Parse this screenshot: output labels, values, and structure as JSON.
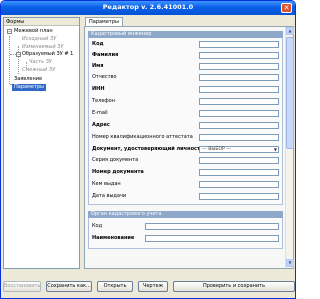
{
  "window": {
    "title": "Редактор v. 2.6.41001.0",
    "close_glyph": "✕"
  },
  "left": {
    "header": "Формы",
    "tree": [
      {
        "label": "Межевой план",
        "expander": "−"
      },
      {
        "label": "Исходный ЗУ"
      },
      {
        "label": "Изменяемый ЗУ"
      },
      {
        "label": "Образуемый ЗУ # 1",
        "expander": "−"
      },
      {
        "label": "Часть ЗУ"
      },
      {
        "label": "Смежный ЗУ"
      },
      {
        "label": "Заявление"
      },
      {
        "label": "Параметры"
      }
    ]
  },
  "right": {
    "tab": "Параметры",
    "engineer": {
      "section": "Кадастровый инженер",
      "fields": [
        {
          "label": "Код"
        },
        {
          "label": "Фамилия"
        },
        {
          "label": "Имя"
        },
        {
          "label": "Отчество"
        },
        {
          "label": "ИНН"
        },
        {
          "label": "Телефон"
        },
        {
          "label": "E-mail"
        },
        {
          "label": "Адрес"
        },
        {
          "label": "Номер квалификационного аттестата"
        },
        {
          "label": "Документ, удостоверяющий личность",
          "value": "--- ВЫБОР ---"
        },
        {
          "label": "Серия документа"
        },
        {
          "label": "Номер документа"
        },
        {
          "label": "Кем выдан"
        },
        {
          "label": "Дата выдачи"
        }
      ]
    },
    "organ": {
      "section": "Орган кадастрового учета",
      "fields": [
        {
          "label": "Код"
        },
        {
          "label": "Наименование"
        }
      ]
    }
  },
  "buttons": {
    "restore": "Восстановить",
    "save_as": "Сохранить как...",
    "open": "Открыть",
    "drawing": "Чертеж",
    "check_save": "Проверить и сохранить"
  },
  "icons": {
    "close": "close-icon",
    "scroll_up": "arrow-up-icon",
    "scroll_down": "arrow-down-icon",
    "dropdown": "chevron-down-icon",
    "expander": "minus-box-icon"
  }
}
